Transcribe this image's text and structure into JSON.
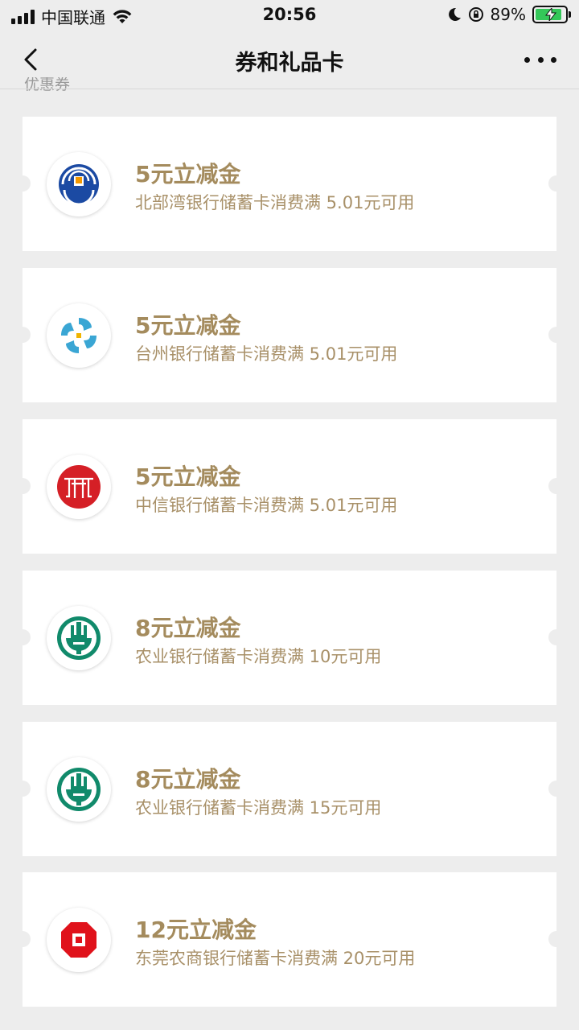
{
  "status_bar": {
    "carrier": "中国联通",
    "time": "20:56",
    "battery": "89%",
    "battery_level": 0.89
  },
  "nav": {
    "title": "券和礼品卡"
  },
  "section_label": "优惠券",
  "colors": {
    "gold_text": "#a48b5d",
    "background": "#ededed",
    "card": "#ffffff"
  },
  "coupons": [
    {
      "title": "5元立减金",
      "desc": "北部湾银行储蓄卡消费满 5.01元可用",
      "logo": "beibuwan-bank-logo-icon"
    },
    {
      "title": "5元立减金",
      "desc": "台州银行储蓄卡消费满 5.01元可用",
      "logo": "taizhou-bank-logo-icon"
    },
    {
      "title": "5元立减金",
      "desc": "中信银行储蓄卡消费满 5.01元可用",
      "logo": "citic-bank-logo-icon"
    },
    {
      "title": "8元立减金",
      "desc": "农业银行储蓄卡消费满 10元可用",
      "logo": "abc-bank-logo-icon"
    },
    {
      "title": "8元立减金",
      "desc": "农业银行储蓄卡消费满 15元可用",
      "logo": "abc-bank-logo-icon"
    },
    {
      "title": "12元立减金",
      "desc": "东莞农商银行储蓄卡消费满 20元可用",
      "logo": "dongguan-rural-bank-logo-icon"
    }
  ]
}
